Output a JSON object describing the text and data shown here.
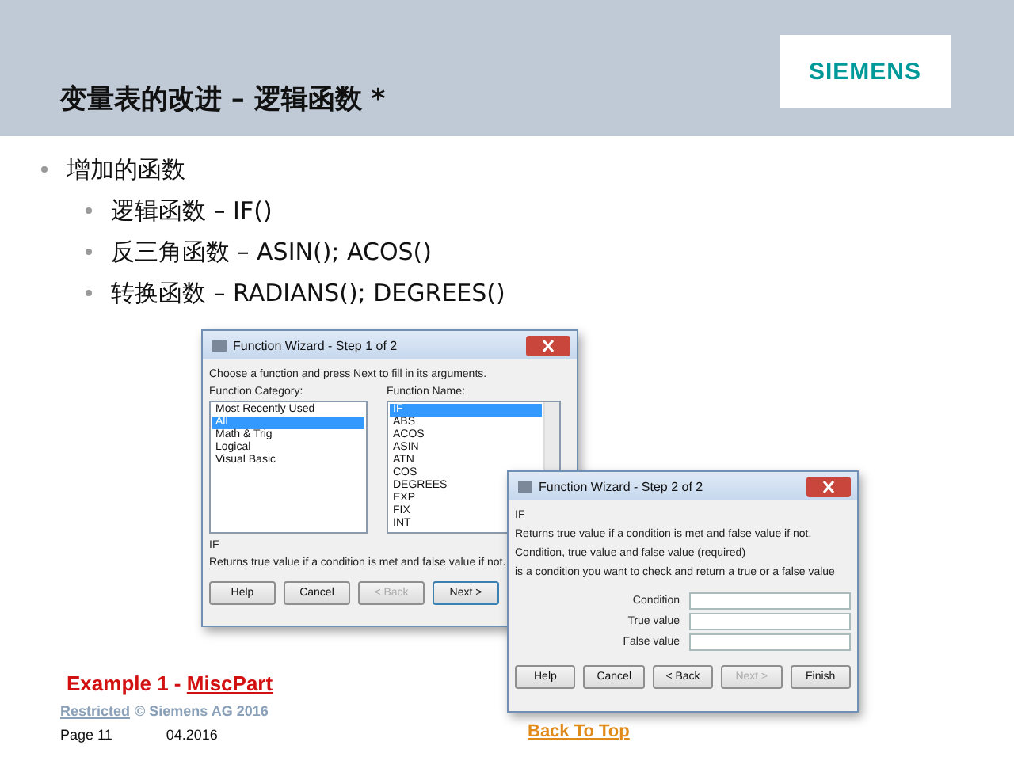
{
  "header": {
    "title": "变量表的改进 – 逻辑函数 *",
    "logo": "SIEMENS"
  },
  "bullets": [
    {
      "text": "增加的函数",
      "children": [
        {
          "text": "逻辑函数 – IF()"
        },
        {
          "text": "反三角函数 – ASIN(); ACOS()"
        },
        {
          "text": "转换函数 – RADIANS(); DEGREES()"
        }
      ]
    }
  ],
  "dialog_step1": {
    "title": "Function Wizard - Step 1 of 2",
    "prompt": "Choose a function and press Next to fill in its arguments.",
    "category_label": "Function Category:",
    "categories": [
      {
        "label": "Most Recently Used",
        "selected": false
      },
      {
        "label": "All",
        "selected": true
      },
      {
        "label": "Math & Trig",
        "selected": false
      },
      {
        "label": "Logical",
        "selected": false
      },
      {
        "label": "Visual Basic",
        "selected": false
      }
    ],
    "function_label": "Function Name:",
    "functions": [
      {
        "label": "IF",
        "selected": true
      },
      {
        "label": "ABS",
        "selected": false
      },
      {
        "label": "ACOS",
        "selected": false
      },
      {
        "label": "ASIN",
        "selected": false
      },
      {
        "label": "ATN",
        "selected": false
      },
      {
        "label": "COS",
        "selected": false
      },
      {
        "label": "DEGREES",
        "selected": false
      },
      {
        "label": "EXP",
        "selected": false
      },
      {
        "label": "FIX",
        "selected": false
      },
      {
        "label": "INT",
        "selected": false
      }
    ],
    "name": "IF",
    "description": "Returns true value if a condition is met and false value if not.",
    "buttons": [
      {
        "label": "Help",
        "disabled": false,
        "default": false
      },
      {
        "label": "Cancel",
        "disabled": false,
        "default": false
      },
      {
        "label": "< Back",
        "disabled": true,
        "default": false
      },
      {
        "label": "Next >",
        "disabled": false,
        "default": true
      }
    ]
  },
  "dialog_step2": {
    "title": "Function Wizard - Step 2 of 2",
    "name": "IF",
    "description": "Returns true value if a condition is met and false value if not.",
    "args_heading": "Condition, true value and false value (required)",
    "args_hint": "is a condition you want to check and return a true or a false value",
    "fields": [
      {
        "label": "Condition"
      },
      {
        "label": "True value"
      },
      {
        "label": "False value"
      }
    ],
    "buttons": [
      {
        "label": "Help",
        "disabled": false,
        "default": false
      },
      {
        "label": "Cancel",
        "disabled": false,
        "default": false
      },
      {
        "label": "< Back",
        "disabled": false,
        "default": false
      },
      {
        "label": "Next >",
        "disabled": true,
        "default": false
      },
      {
        "label": "Finish",
        "disabled": false,
        "default": false
      }
    ]
  },
  "footer": {
    "example": "Example 1 - ",
    "example_link": "MiscPart",
    "restricted_link": "Restricted",
    "copyright": "© Siemens AG 2016",
    "page": "Page 11",
    "date": "04.2016",
    "back_to_top": "Back To Top"
  }
}
